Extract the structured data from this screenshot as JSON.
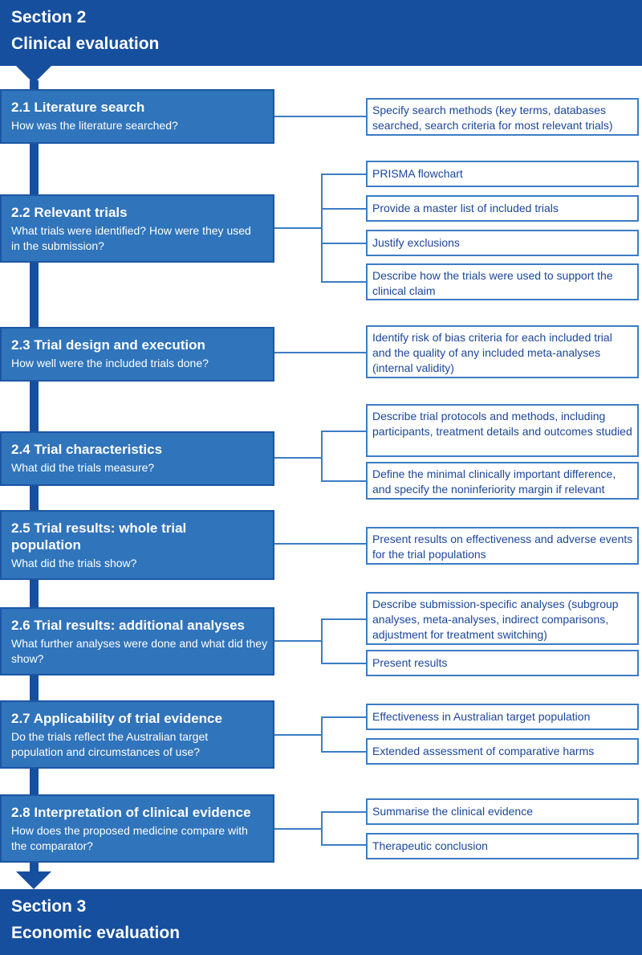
{
  "top_section": {
    "line1": "Section 2",
    "line2": "Clinical evaluation"
  },
  "bottom_section": {
    "line1": "Section 3",
    "line2": "Economic evaluation"
  },
  "steps": [
    {
      "title": "2.1 Literature search",
      "question": "How was the literature searched?",
      "items": [
        "Specify search methods (key terms, databases searched, search criteria for most relevant trials)"
      ]
    },
    {
      "title": "2.2 Relevant trials",
      "question": "What trials were identified? How were they used in the submission?",
      "items": [
        "PRISMA flowchart",
        "Provide a master list of included trials",
        "Justify exclusions",
        "Describe how the trials were used to support the clinical claim"
      ]
    },
    {
      "title": "2.3 Trial design and execution",
      "question": "How well were the included trials done?",
      "items": [
        "Identify risk of bias criteria for each included trial and the quality of any included meta-analyses (internal validity)"
      ]
    },
    {
      "title": "2.4 Trial characteristics",
      "question": "What did the trials measure?",
      "items": [
        "Describe trial protocols and methods, including participants, treatment details and outcomes studied",
        "Define the minimal clinically important difference, and specify the noninferiority margin if relevant"
      ]
    },
    {
      "title": "2.5 Trial results: whole trial population",
      "question": "What did the trials show?",
      "items": [
        "Present results on effectiveness and adverse events for the trial populations"
      ]
    },
    {
      "title": "2.6 Trial results: additional analyses",
      "question": "What further analyses were done and what did they show?",
      "items": [
        "Describe submission-specific analyses (subgroup analyses, meta-analyses, indirect comparisons, adjustment for treatment switching)",
        "Present results"
      ]
    },
    {
      "title": "2.7 Applicability of trial evidence",
      "question": "Do the trials reflect the Australian target population and circumstances of use?",
      "items": [
        "Effectiveness in Australian target population",
        "Extended assessment of comparative harms"
      ]
    },
    {
      "title": "2.8 Interpretation of clinical evidence",
      "question": "How does the proposed medicine compare with the comparator?",
      "items": [
        "Summarise the clinical evidence",
        "Therapeutic conclusion"
      ]
    }
  ]
}
